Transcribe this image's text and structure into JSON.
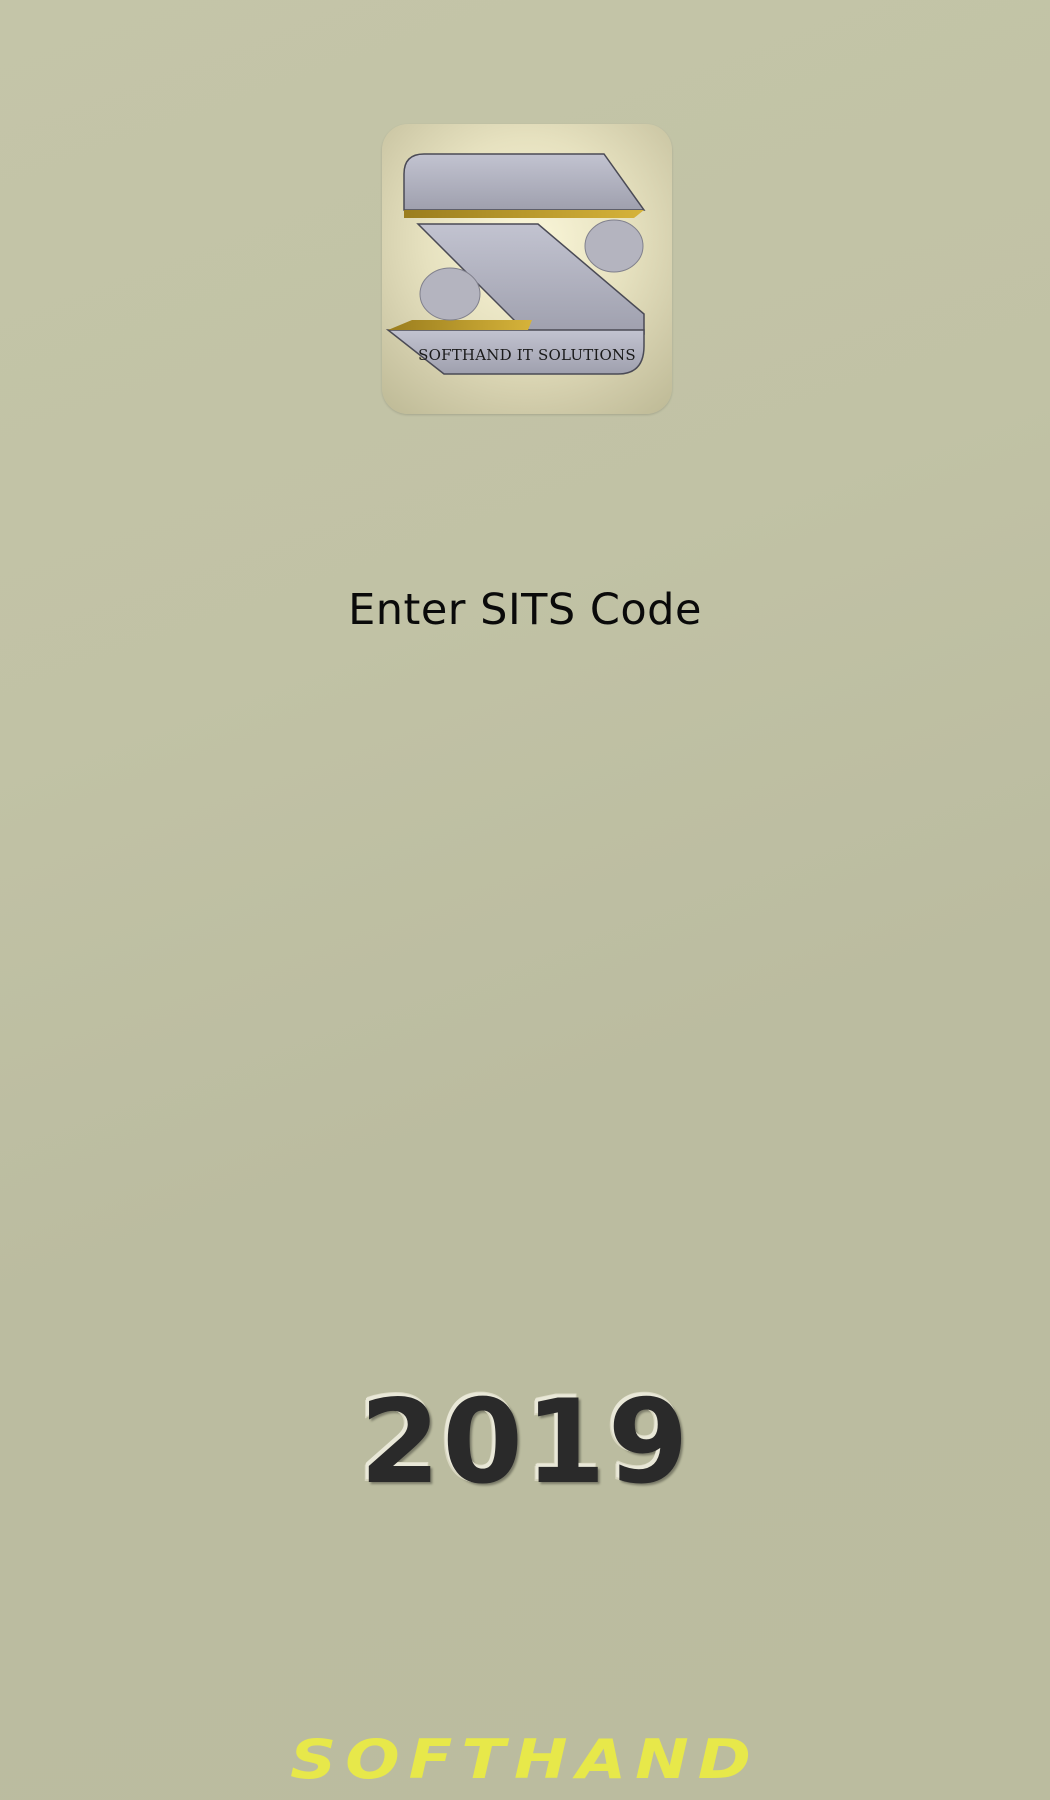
{
  "logo": {
    "caption": "SOFTHAND IT SOLUTIONS",
    "icon": "softhand-s-logo-icon"
  },
  "title": "Enter SITS Code",
  "year": "2019",
  "brand": "SOFTHAND",
  "colors": {
    "background": "#c1c2a5",
    "title": "#0a0a0a",
    "brand": "#e7e84a"
  }
}
